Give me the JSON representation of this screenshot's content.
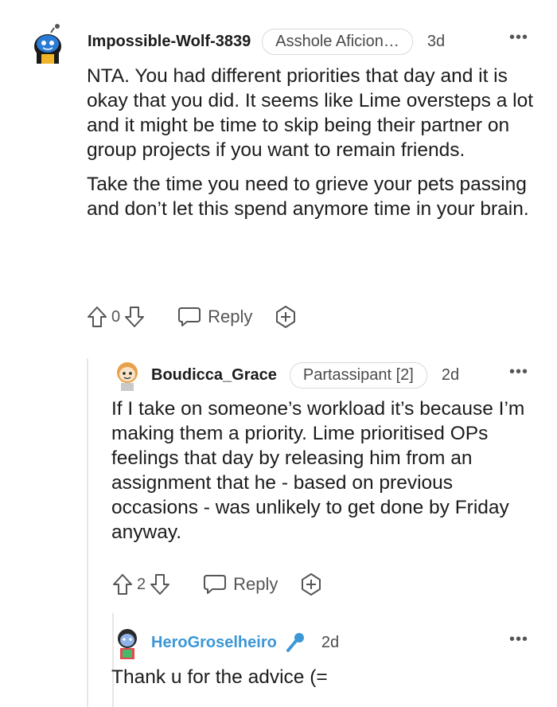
{
  "comments": [
    {
      "username": "Impossible-Wolf-3839",
      "flair": "Asshole Aficion…",
      "time": "3d",
      "paragraphs": [
        "NTA. You had different priorities that day and it is okay that you did. It seems like Lime oversteps a lot and it might be time to skip being their partner on group projects if you want to remain friends.",
        "Take the time you need to grieve your pets passing and don’t let this spend anymore time in your brain."
      ],
      "votes": "0",
      "reply_label": "Reply"
    },
    {
      "username": "Boudicca_Grace",
      "flair": "Partassipant [2]",
      "time": "2d",
      "paragraphs": [
        "If I take on someone’s workload it’s because I’m making them a priority. Lime prioritised OPs feelings that day by releasing him from an assignment that he - based on previous occasions - was unlikely to get done by Friday anyway."
      ],
      "votes": "2",
      "reply_label": "Reply"
    },
    {
      "username": "HeroGroselheiro",
      "time": "2d",
      "paragraphs": [
        "Thank u for the advice (="
      ]
    }
  ],
  "icons": {
    "upvote": "arrow-up-outline",
    "downvote": "arrow-down-outline",
    "reply": "speech-bubble",
    "award": "plus-badge",
    "more": "ellipsis",
    "op_badge": "microphone"
  },
  "colors": {
    "op_username": "#3d97d6",
    "text": "#1c1c1c",
    "muted": "#555555"
  }
}
